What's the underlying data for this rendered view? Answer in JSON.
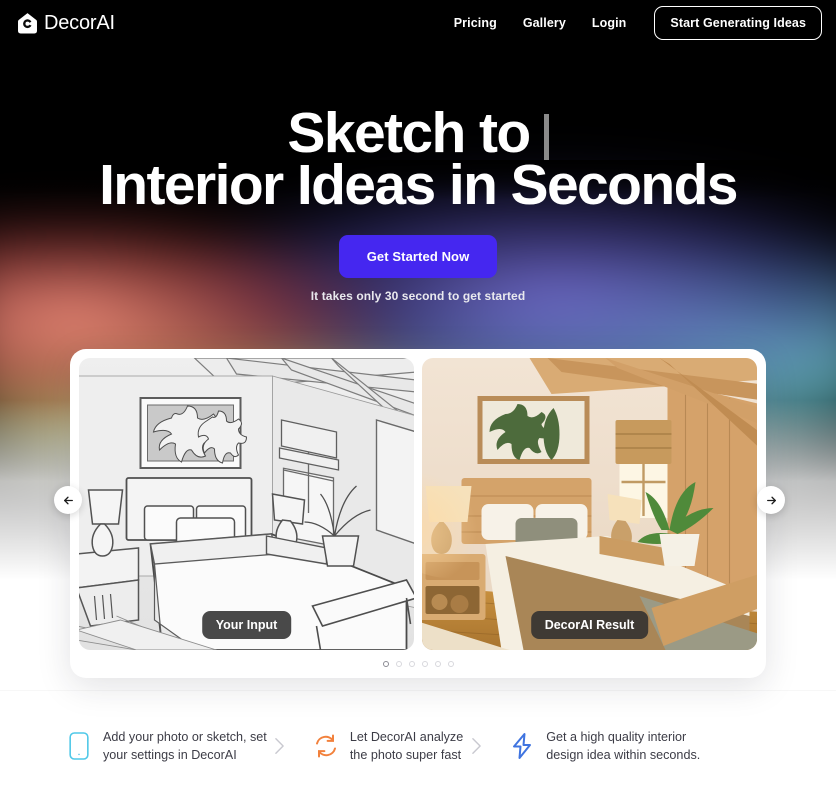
{
  "brand": {
    "name": "DecorAI",
    "logo_icon": "house-aperture-logo-icon"
  },
  "nav": {
    "links": [
      {
        "label": "Pricing",
        "name": "nav-link-pricing"
      },
      {
        "label": "Gallery",
        "name": "nav-link-gallery"
      },
      {
        "label": "Login",
        "name": "nav-link-login"
      }
    ],
    "cta_label": "Start Generating Ideas"
  },
  "hero": {
    "headline_line1": "Sketch to",
    "headline_line2": "Interior Ideas in Seconds",
    "caret": "typing-caret",
    "cta_label": "Get Started Now",
    "subtext": "It takes only 30 second to get started",
    "cta_color": "#4527f0"
  },
  "carousel": {
    "prev_icon": "arrow-left-icon",
    "next_icon": "arrow-right-icon",
    "slides": [
      {
        "label": "Your Input",
        "alt": "pencil sketch of a bedroom interior"
      },
      {
        "label": "DecorAI Result",
        "alt": "AI rendered warm wooden bedroom interior"
      }
    ],
    "dot_count": 6,
    "active_dot": 1
  },
  "features": [
    {
      "icon": "phone-outline-icon",
      "icon_color": "#4fc8e8",
      "line1": "Add your photo or sketch, set",
      "line2": "your settings in DecorAI"
    },
    {
      "icon": "refresh-rotate-icon",
      "icon_color": "#f2813c",
      "line1": "Let DecorAI analyze",
      "line2": "the photo super fast"
    },
    {
      "icon": "lightning-bolt-icon",
      "icon_color": "#3f74e0",
      "line1": "Get a high quality interior",
      "line2": "design idea within seconds."
    }
  ],
  "separator_icon": "chevron-right-icon"
}
